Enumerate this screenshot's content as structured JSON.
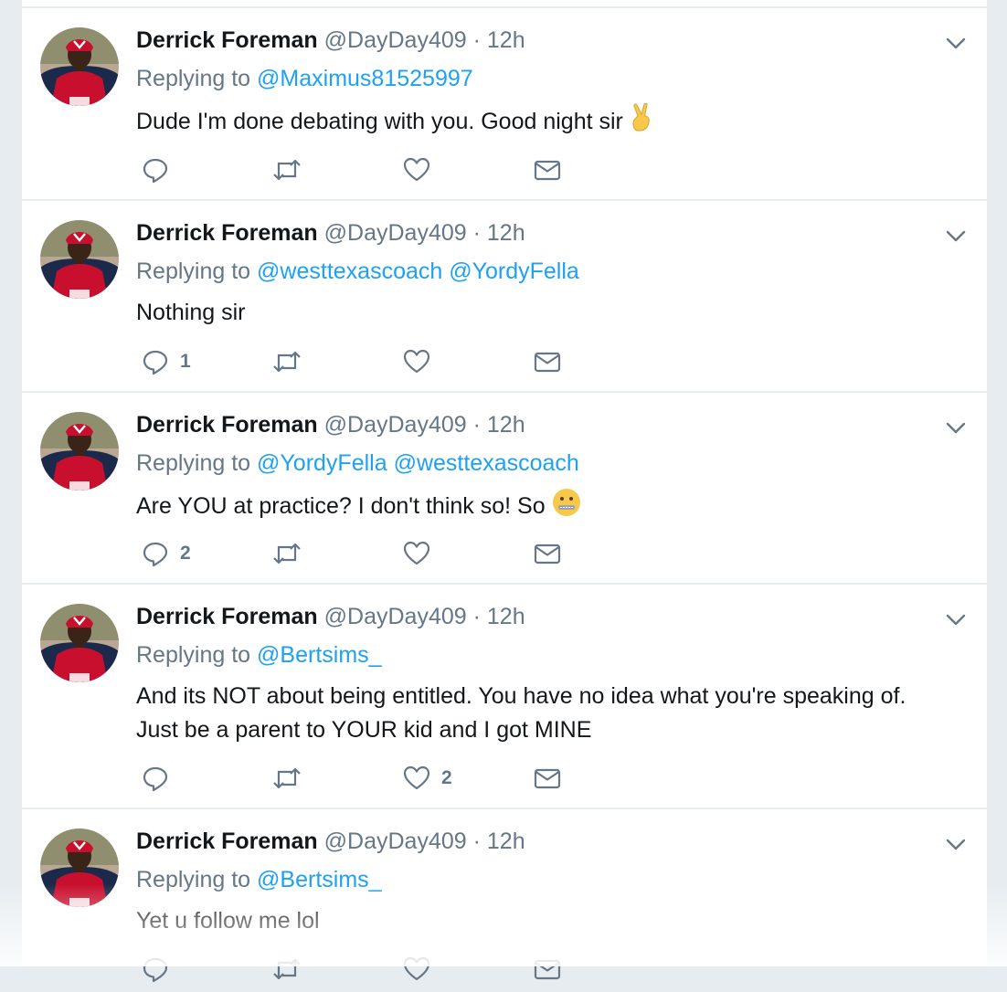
{
  "tweets": [
    {
      "name": "Derrick Foreman",
      "handle": "@DayDay409",
      "dot": "·",
      "time": "12h",
      "replying_prefix": "Replying to",
      "mentions": [
        "@Maximus81525997"
      ],
      "text_lines": [
        "Dude I'm done debating with you. Good night sir"
      ],
      "emoji": "victory-hand",
      "reply_count": "",
      "retweet_count": "",
      "like_count": ""
    },
    {
      "name": "Derrick Foreman",
      "handle": "@DayDay409",
      "dot": "·",
      "time": "12h",
      "replying_prefix": "Replying to",
      "mentions": [
        "@westtexascoach",
        "@YordyFella"
      ],
      "text_lines": [
        "Nothing sir"
      ],
      "emoji": "",
      "reply_count": "1",
      "retweet_count": "",
      "like_count": ""
    },
    {
      "name": "Derrick Foreman",
      "handle": "@DayDay409",
      "dot": "·",
      "time": "12h",
      "replying_prefix": "Replying to",
      "mentions": [
        "@YordyFella",
        "@westtexascoach"
      ],
      "text_lines": [
        "Are YOU at practice? I don't think so! So"
      ],
      "emoji": "zipper-mouth-face",
      "reply_count": "2",
      "retweet_count": "",
      "like_count": ""
    },
    {
      "name": "Derrick Foreman",
      "handle": "@DayDay409",
      "dot": "·",
      "time": "12h",
      "replying_prefix": "Replying to",
      "mentions": [
        "@Bertsims_"
      ],
      "text_lines": [
        "And its NOT about being entitled. You have no idea what you're speaking of.",
        "Just be a parent to YOUR kid and I got MINE"
      ],
      "emoji": "",
      "reply_count": "",
      "retweet_count": "",
      "like_count": "2"
    },
    {
      "name": "Derrick Foreman",
      "handle": "@DayDay409",
      "dot": "·",
      "time": "12h",
      "replying_prefix": "Replying to",
      "mentions": [
        "@Bertsims_"
      ],
      "text_lines": [
        "Yet u follow me lol"
      ],
      "emoji": "",
      "reply_count": "",
      "retweet_count": "",
      "like_count": ""
    }
  ],
  "colors": {
    "name": "#14171a",
    "muted": "#657786",
    "link": "#1da1f2",
    "divider": "#e6ecf0",
    "jersey_red": "#c8102e",
    "jersey_navy": "#1b2a4a"
  },
  "icons": [
    "reply-icon",
    "retweet-icon",
    "like-icon",
    "direct-message-icon",
    "chevron-down-icon"
  ]
}
